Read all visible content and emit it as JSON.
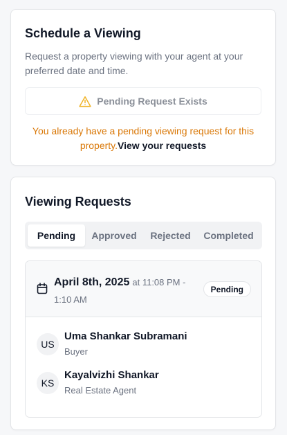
{
  "schedule": {
    "title": "Schedule a Viewing",
    "description": "Request a property viewing with your agent at your preferred date and time.",
    "pending_label": "Pending Request Exists",
    "pending_icon": "warning-triangle-icon",
    "warning_text": "You already have a pending viewing request for this property.",
    "view_link": "View your requests",
    "warning_color": "#d97706"
  },
  "requests": {
    "title": "Viewing Requests",
    "tabs": [
      {
        "label": "Pending",
        "active": true
      },
      {
        "label": "Approved",
        "active": false
      },
      {
        "label": "Rejected",
        "active": false
      },
      {
        "label": "Completed",
        "active": false
      }
    ],
    "items": [
      {
        "date": "April 8th, 2025",
        "time": "at 11:08 PM - 1:10 AM",
        "status": "Pending",
        "icon": "calendar-icon",
        "people": [
          {
            "initials": "US",
            "name": "Uma Shankar Subramani",
            "role": "Buyer"
          },
          {
            "initials": "KS",
            "name": "Kayalvizhi Shankar",
            "role": "Real Estate Agent"
          }
        ]
      }
    ]
  }
}
